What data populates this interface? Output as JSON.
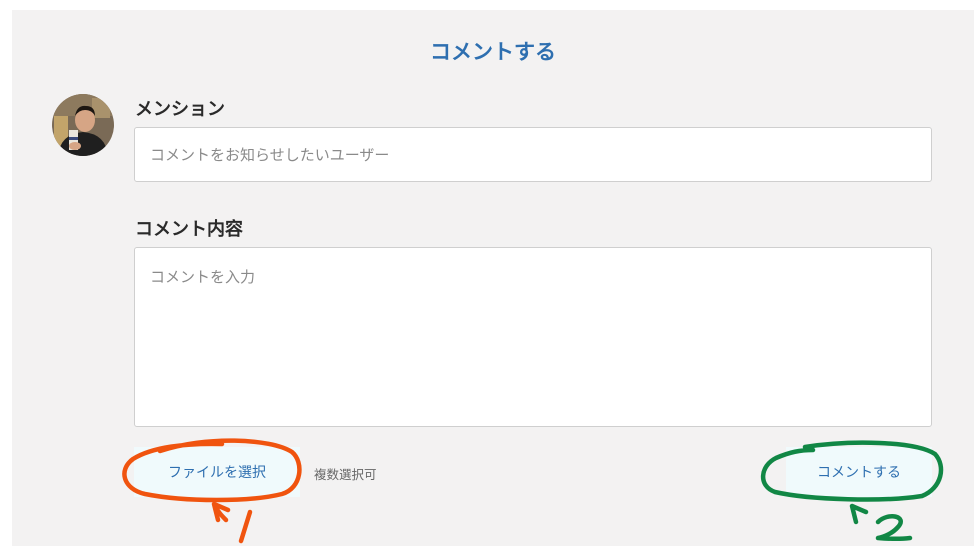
{
  "form": {
    "title": "コメントする",
    "mention_label": "メンション",
    "mention_placeholder": "コメントをお知らせしたいユーザー",
    "comment_label": "コメント内容",
    "comment_placeholder": "コメントを入力",
    "file_button_label": "ファイルを選択",
    "file_hint": "複数選択可",
    "submit_label": "コメントする"
  },
  "annotations": {
    "marker_1": "1",
    "marker_2": "2",
    "color_1": "#f0540f",
    "color_2": "#118745"
  },
  "colors": {
    "accent": "#2e6fb0",
    "panel_bg": "#f3f2f2",
    "button_bg": "#f0fafc"
  }
}
